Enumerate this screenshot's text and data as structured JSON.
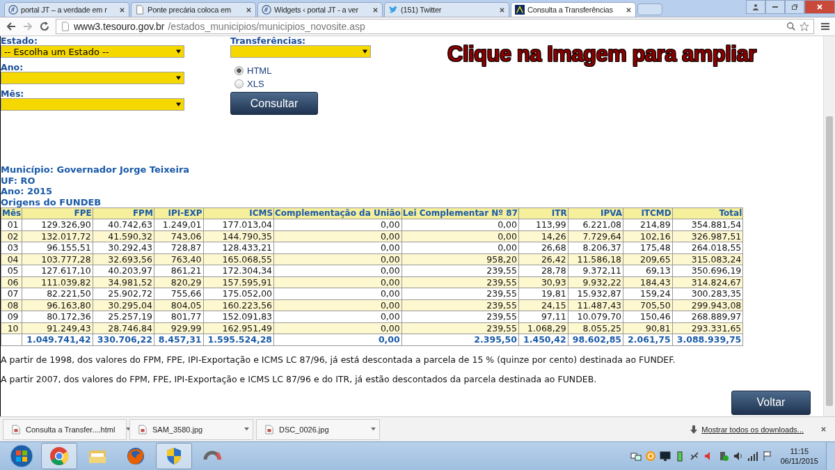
{
  "browser": {
    "tabs": [
      {
        "kind": "jt",
        "title": "portal JT – a verdade em r",
        "selected": false
      },
      {
        "kind": "page",
        "title": "Ponte precária coloca em",
        "selected": false
      },
      {
        "kind": "jt",
        "title": "Widgets ‹ portal JT - a ver",
        "selected": false
      },
      {
        "kind": "twitter",
        "title": "(151) Twitter",
        "selected": false
      },
      {
        "kind": "tesouro",
        "title": "Consulta a Transferências",
        "selected": true
      }
    ],
    "address": {
      "host": "www3.tesouro.gov.br",
      "path": "/estados_municipios/municipios_novosite.asp"
    }
  },
  "form": {
    "estado": {
      "label": "Estado:",
      "value": "-- Escolha um Estado --"
    },
    "ano": {
      "label": "Ano:"
    },
    "mes": {
      "label": "Mês:"
    },
    "transferencias": {
      "label": "Transferências:"
    },
    "format": [
      {
        "label": "HTML",
        "selected": true
      },
      {
        "label": "XLS",
        "selected": false
      }
    ],
    "submit": "Consultar"
  },
  "banner": "Clique na Imagem para ampliar",
  "info": [
    "Município: Governador Jorge Teixeira",
    "UF: RO",
    "Ano: 2015",
    "Origens do FUNDEB"
  ],
  "table": {
    "columns": [
      "Mês",
      "FPE",
      "FPM",
      "IPI-EXP",
      "ICMS",
      "Complementação da União",
      "Lei Complementar Nº 87",
      "ITR",
      "IPVA",
      "ITCMD",
      "Total"
    ],
    "rows": [
      [
        "01",
        "129.326,90",
        "40.742,63",
        "1.249,01",
        "177.013,04",
        "0,00",
        "0,00",
        "113,99",
        "6.221,08",
        "214,89",
        "354.881,54"
      ],
      [
        "02",
        "132.017,72",
        "41.590,32",
        "743,06",
        "144.790,35",
        "0,00",
        "0,00",
        "14,26",
        "7.729,64",
        "102,16",
        "326.987,51"
      ],
      [
        "03",
        "96.155,51",
        "30.292,43",
        "728,87",
        "128.433,21",
        "0,00",
        "0,00",
        "26,68",
        "8.206,37",
        "175,48",
        "264.018,55"
      ],
      [
        "04",
        "103.777,28",
        "32.693,56",
        "763,40",
        "165.068,55",
        "0,00",
        "958,20",
        "26,42",
        "11.586,18",
        "209,65",
        "315.083,24"
      ],
      [
        "05",
        "127.617,10",
        "40.203,97",
        "861,21",
        "172.304,34",
        "0,00",
        "239,55",
        "28,78",
        "9.372,11",
        "69,13",
        "350.696,19"
      ],
      [
        "06",
        "111.039,82",
        "34.981,52",
        "820,29",
        "157.595,91",
        "0,00",
        "239,55",
        "30,93",
        "9.932,22",
        "184,43",
        "314.824,67"
      ],
      [
        "07",
        "82.221,50",
        "25.902,72",
        "755,66",
        "175.052,00",
        "0,00",
        "239,55",
        "19,81",
        "15.932,87",
        "159,24",
        "300.283,35"
      ],
      [
        "08",
        "96.163,80",
        "30.295,04",
        "804,05",
        "160.223,56",
        "0,00",
        "239,55",
        "24,15",
        "11.487,43",
        "705,50",
        "299.943,08"
      ],
      [
        "09",
        "80.172,36",
        "25.257,19",
        "801,77",
        "152.091,83",
        "0,00",
        "239,55",
        "97,11",
        "10.079,70",
        "150,46",
        "268.889,97"
      ],
      [
        "10",
        "91.249,43",
        "28.746,84",
        "929,99",
        "162.951,49",
        "0,00",
        "239,55",
        "1.068,29",
        "8.055,25",
        "90,81",
        "293.331,65"
      ]
    ],
    "totals": [
      "1.049.741,42",
      "330.706,22",
      "8.457,31",
      "1.595.524,28",
      "0,00",
      "2.395,50",
      "1.450,42",
      "98.602,85",
      "2.061,75",
      "3.088.939,75"
    ]
  },
  "notes": [
    "A partir de 1998, dos valores do FPM, FPE, IPI-Exportação e ICMS LC 87/96, já está descontada a parcela de 15 % (quinze por cento) destinada ao FUNDEF.",
    "A partir 2007, dos valores do FPM, FPE, IPI-Exportação e ICMS LC 87/96 e do ITR, já estão descontados da parcela destinada ao FUNDEB."
  ],
  "back_button": "Voltar",
  "downloads": {
    "items": [
      {
        "name": "Consulta a Transfer....html"
      },
      {
        "name": "SAM_3580.jpg"
      },
      {
        "name": "DSC_0026.jpg"
      }
    ],
    "show_all": "Mostrar todos os downloads..."
  },
  "taskbar": {
    "apps": [
      {
        "kind": "chrome",
        "selected": true
      },
      {
        "kind": "folder",
        "selected": false
      },
      {
        "kind": "firefox",
        "selected": false
      },
      {
        "kind": "shield",
        "selected": true
      },
      {
        "kind": "ring",
        "selected": false
      }
    ],
    "time": "11:15",
    "date": "06/11/2015"
  }
}
